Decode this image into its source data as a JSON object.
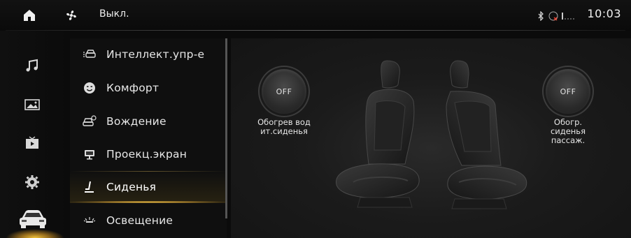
{
  "statusbar": {
    "fan_status": "Выкл.",
    "time": "10:03",
    "icons": [
      "home-icon",
      "fan-icon",
      "bluetooth-icon",
      "no-signal-icon",
      "signal-bars-icon"
    ]
  },
  "rail": {
    "items": [
      {
        "icon": "music-note-icon"
      },
      {
        "icon": "gallery-icon"
      },
      {
        "icon": "video-player-icon"
      },
      {
        "icon": "gear-icon"
      },
      {
        "icon": "car-icon",
        "active": true
      }
    ]
  },
  "menu": {
    "items": [
      {
        "label": "Интеллект.упр-е",
        "icon": "smart-car-icon"
      },
      {
        "label": "Комфорт",
        "icon": "smiley-face-icon"
      },
      {
        "label": "Вождение",
        "icon": "car-gear-icon"
      },
      {
        "label": "Проекц.экран",
        "icon": "monitor-icon"
      },
      {
        "label": "Сиденья",
        "icon": "seat-icon",
        "active": true
      },
      {
        "label": "Освещение",
        "icon": "light-icon"
      }
    ]
  },
  "seats": {
    "driver": {
      "state": "OFF",
      "caption_line1": "Обогрев вод",
      "caption_line2": "ит.сиденья"
    },
    "passenger": {
      "state": "OFF",
      "caption_line1": "Обогр.",
      "caption_line2": "сиденья",
      "caption_line3": "пассаж."
    }
  },
  "colors": {
    "accent": "#ffcc44",
    "background": "#0b0b0b",
    "panel": "#1b1b1b"
  }
}
